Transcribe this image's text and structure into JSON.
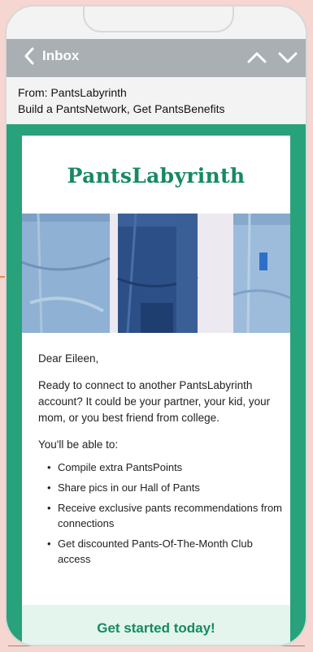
{
  "navbar": {
    "back_label": "Inbox"
  },
  "message": {
    "from": "From: PantsLabyrinth",
    "subject": "Build a PantsNetwork, Get PantsBenefits"
  },
  "email": {
    "brand": "PantsLabyrinth",
    "greeting": "Dear Eileen,",
    "intro": "Ready to connect to another PantsLabyrinth account? It could be your partner, your kid, your mom, or you best friend from college.",
    "list_intro": "You'll be able to:",
    "benefits": [
      "Compile extra PantsPoints",
      "Share pics in our Hall of Pants",
      "Receive exclusive pants recommendations from connections",
      "Get discounted Pants-Of-The-Month Club access"
    ],
    "cta": "Get started today!"
  },
  "colors": {
    "brand_green": "#168a60",
    "frame_green": "#27a27a",
    "navbar_gray": "#a9afb3",
    "cta_bg": "#e3f5ed"
  }
}
